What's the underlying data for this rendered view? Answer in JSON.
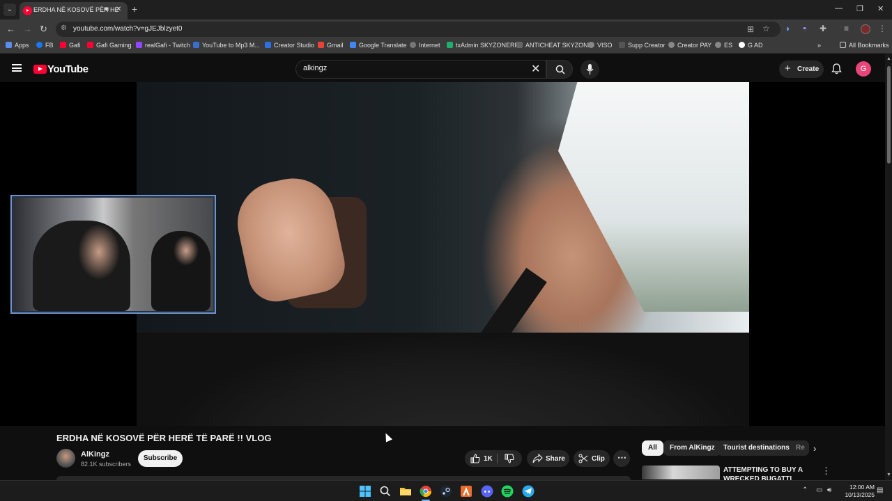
{
  "browser": {
    "tab_title": "ERDHA NË KOSOVË PËR HERË TË PARË !! VLOG",
    "url": "youtube.com/watch?v=gJEJblzyet0",
    "bookmarks": [
      "Apps",
      "FB",
      "Gafi",
      "Gafi Gaming",
      "realGafi - Twitch",
      "YouTube to Mp3 M...",
      "Creator Studio",
      "Gmail",
      "Google Translate",
      "Internet",
      "txAdmin SKYZONERP",
      "ANTICHEAT SKYZONE",
      "VISO",
      "Supp Creator",
      "Creator PAY",
      "ES",
      "G AD"
    ],
    "all_bookmarks": "All Bookmarks"
  },
  "youtube": {
    "logo_text": "YouTube",
    "search_value": "alkingz",
    "create_label": "Create",
    "avatar_letter": "G"
  },
  "video": {
    "title": "ERDHA NË KOSOVË PËR HERË TË PARË !! VLOG",
    "channel": "AlKingz",
    "subscribers": "82.1K subscribers",
    "subscribe_label": "Subscribe",
    "likes": "1K",
    "share_label": "Share",
    "clip_label": "Clip"
  },
  "sidebar": {
    "chips": [
      "All",
      "From AlKingz",
      "Tourist destinations",
      "Re"
    ],
    "recommended_title": "ATTEMPTING TO BUY A WRECKED BUGATTI CHIRON"
  },
  "taskbar": {
    "time": "12:00 AM",
    "date": "10/13/2025"
  },
  "colors": {
    "youtube_red": "#ff0033",
    "background": "#0f0f0f",
    "avatar_pink": "#e9457b"
  }
}
